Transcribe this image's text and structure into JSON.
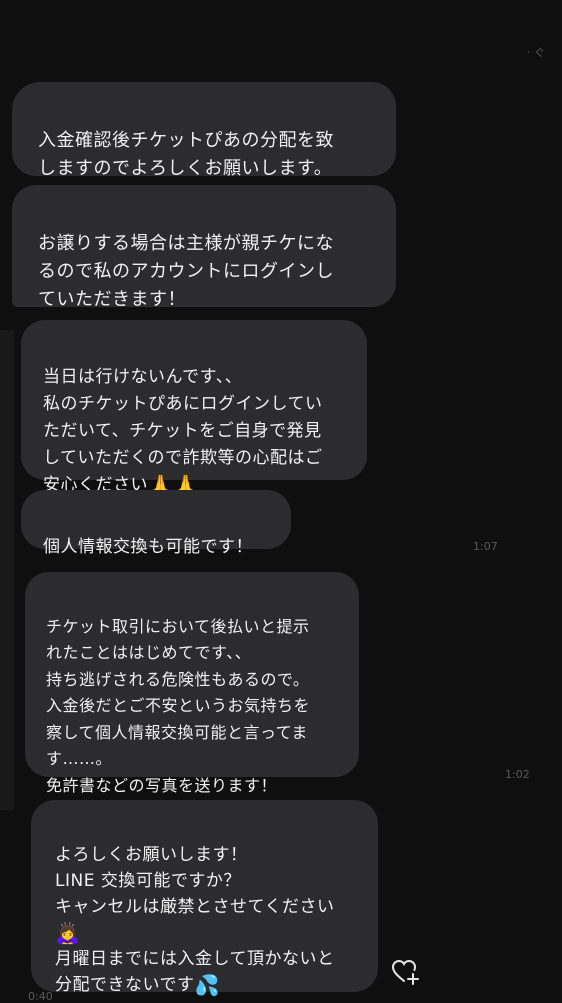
{
  "messages": [
    {
      "text": "入金確認後チケットぴあの分配を致\nしますのでよろしくお願いします。"
    },
    {
      "text": "お譲りする場合は主様が親チケにな\nるので私のアカウントにログインし\nていただきます！"
    },
    {
      "text": "当日は行けないんです、、\n私のチケットぴあにログインしてい\nただいて、チケットをご自身で発見\nしていただくので詐欺等の心配はご\n安心ください",
      "emoji": "🙏🙏"
    },
    {
      "text": "個人情報交換も可能です！"
    },
    {
      "text": "チケット取引において後払いと提示\nれたことははじめてです、、\n持ち逃げされる危険性もあるので。\n入金後だとご不安というお気持ちを\n察して個人情報交換可能と言ってま\nす……。\n免許書などの写真を送ります！"
    },
    {
      "text": "よろしくお願いします！\nLINE 交換可能ですか？\nキャンセルは厳禁とさせてください",
      "emoji": "🙇‍♀️",
      "text2": "月曜日までには入金して頂かないと\n分配できないです",
      "emoji2": "💦"
    }
  ],
  "timestamps": [
    "· ぐ",
    "1:07",
    "1:02",
    "0:40"
  ],
  "icons": {
    "like": "heart-plus-icon"
  }
}
